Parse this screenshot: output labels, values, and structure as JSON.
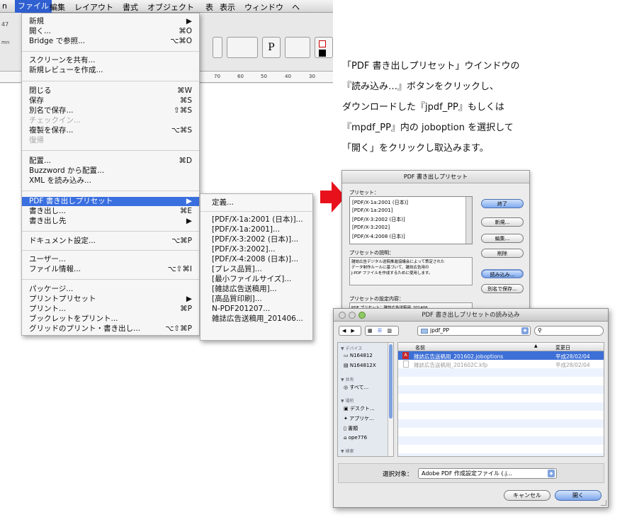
{
  "menubar": {
    "items": [
      "n",
      "ファイル",
      "編集",
      "レイアウト",
      "書式",
      "オブジェクト",
      "表",
      "表示",
      "ウィンドウ",
      "ヘ"
    ]
  },
  "toolbar_fragments": {
    "left_num": "47",
    "left_txt": "mn"
  },
  "ruler": {
    "ticks": [
      "70",
      "60",
      "50",
      "40",
      "30"
    ]
  },
  "file_menu": {
    "items": [
      {
        "label": "新規",
        "shortcut": "▶",
        "state": "normal"
      },
      {
        "label": "開く...",
        "shortcut": "⌘O",
        "state": "normal"
      },
      {
        "label": "Bridge で参照...",
        "shortcut": "⌥⌘O",
        "state": "normal"
      },
      {
        "label": "スクリーンを共有...",
        "shortcut": "",
        "state": "normal"
      },
      {
        "label": "新規レビューを作成...",
        "shortcut": "",
        "state": "normal"
      },
      {
        "label": "閉じる",
        "shortcut": "⌘W",
        "state": "normal"
      },
      {
        "label": "保存",
        "shortcut": "⌘S",
        "state": "normal"
      },
      {
        "label": "別名で保存...",
        "shortcut": "⇧⌘S",
        "state": "normal"
      },
      {
        "label": "チェックイン...",
        "shortcut": "",
        "state": "disabled"
      },
      {
        "label": "複製を保存...",
        "shortcut": "⌥⌘S",
        "state": "normal"
      },
      {
        "label": "復帰",
        "shortcut": "",
        "state": "disabled"
      },
      {
        "label": "配置...",
        "shortcut": "⌘D",
        "state": "normal"
      },
      {
        "label": "Buzzword から配置...",
        "shortcut": "",
        "state": "normal"
      },
      {
        "label": "XML を読み込み...",
        "shortcut": "",
        "state": "normal"
      },
      {
        "label": "PDF 書き出しプリセット",
        "shortcut": "▶",
        "state": "highlighted"
      },
      {
        "label": "書き出し...",
        "shortcut": "⌘E",
        "state": "normal"
      },
      {
        "label": "書き出し先",
        "shortcut": "▶",
        "state": "normal"
      },
      {
        "label": "ドキュメント設定...",
        "shortcut": "⌥⌘P",
        "state": "normal"
      },
      {
        "label": "ユーザー...",
        "shortcut": "",
        "state": "normal"
      },
      {
        "label": "ファイル情報...",
        "shortcut": "⌥⇧⌘I",
        "state": "normal"
      },
      {
        "label": "パッケージ...",
        "shortcut": "",
        "state": "normal"
      },
      {
        "label": "プリントプリセット",
        "shortcut": "▶",
        "state": "normal"
      },
      {
        "label": "プリント...",
        "shortcut": "⌘P",
        "state": "normal"
      },
      {
        "label": "ブックレットをプリント...",
        "shortcut": "",
        "state": "normal"
      },
      {
        "label": "グリッドのプリント・書き出し...",
        "shortcut": "⌥⇧⌘P",
        "state": "normal"
      }
    ]
  },
  "submenu": {
    "items": [
      "定義...",
      "[PDF/X-1a:2001 (日本)]...",
      "[PDF/X-1a:2001]...",
      "[PDF/X-3:2002 (日本)]...",
      "[PDF/X-3:2002]...",
      "[PDF/X-4:2008 (日本)]...",
      "[プレス品質]...",
      "[最小ファイルサイズ]...",
      "[雑誌広告送稿用]...",
      "[高品質印刷]...",
      "N-PDF201207...",
      "雑誌広告送稿用_201406..."
    ]
  },
  "instructions": [
    "「PDF 書き出しプリセット」ウインドウの",
    "『読み込み…』ボタンをクリックし、",
    "ダウンロードした『jpdf_PP』もしくは",
    "『mpdf_PP』内の joboption を選択して",
    "「開く」をクリックし取込みます。"
  ],
  "preset_dialog": {
    "title": "PDF 書き出しプリセット",
    "presets_label": "プリセット：",
    "presets": [
      "[PDF/X-1a:2001 (日本)]",
      "[PDF/X-1a:2001]",
      "[PDF/X-3:2002 (日本)]",
      "[PDF/X-3:2002]",
      "[PDF/X-4:2008 (日本)]"
    ],
    "buttons": {
      "done": "終了",
      "new": "新規...",
      "edit": "編集...",
      "delete": "削除",
      "load": "読み込み...",
      "save_as": "別名で保存..."
    },
    "desc_label": "プリセットの説明：",
    "desc_lines": [
      "雑誌広告デジタル送稿推進協議会によって策定された",
      "データ制作ルールに基づいて、雑誌広告用の",
      "J-PDF ファイルを作成するために使用します。"
    ],
    "settings_label": "プリセットの設定内容：",
    "settings_line": "PDF プリセット：雑誌広告送稿用_201406"
  },
  "open_dialog": {
    "title": "PDF 書き出しプリセットの読み込み",
    "folder": "jpdf_PP",
    "search_placeholder": "",
    "sidebar": {
      "devices_header": "▼ デバイス",
      "devices": [
        "N164812",
        "N164812X"
      ],
      "shared_header": "▼ 共有",
      "shared": [
        "すべて..."
      ],
      "places_header": "▼ 場所",
      "places": [
        "デスクト…",
        "アプリケ…",
        "書類",
        "ope776"
      ],
      "search_header": "▼ 検索"
    },
    "columns": {
      "name": "名前",
      "modified": "変更日"
    },
    "files": [
      {
        "name": "雑誌広告送稿用_201602.joboptions",
        "date": "平成28/02/04",
        "selected": true
      },
      {
        "name": "雑誌広告送稿用_201602C.kfp",
        "date": "平成28/02/04",
        "selected": false
      }
    ],
    "filter_label": "選択対象：",
    "filter_value": "Adobe PDF 作成設定ファイル (.j...",
    "cancel": "キャンセル",
    "open": "開く"
  },
  "colors": {
    "menu_highlight": "#3a6fe0",
    "arrow": "#e8111b",
    "selection": "#3d6fd6"
  }
}
